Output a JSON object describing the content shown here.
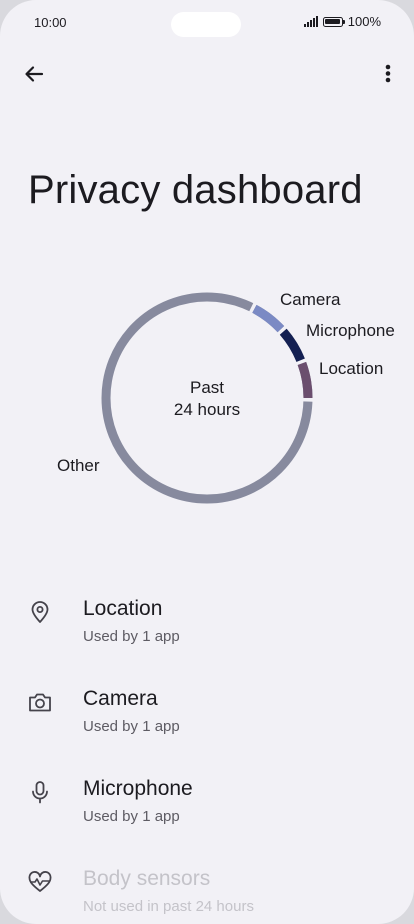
{
  "status_bar": {
    "time": "10:00",
    "battery": "100%"
  },
  "toolbar": {
    "back_icon": "arrow-left-icon",
    "more_icon": "more-vertical-icon"
  },
  "page": {
    "title": "Privacy dashboard"
  },
  "chart_data": {
    "type": "pie",
    "center_label": [
      "Past",
      "24 hours"
    ],
    "slices": [
      {
        "name": "Camera",
        "color": "#7b8ac4"
      },
      {
        "name": "Microphone",
        "color": "#142052"
      },
      {
        "name": "Location",
        "color": "#6b4e6e"
      },
      {
        "name": "Other",
        "color": "#878a9e"
      }
    ]
  },
  "permissions": [
    {
      "name": "Location",
      "status": "Used by 1 app",
      "icon": "location-pin-icon",
      "enabled": true
    },
    {
      "name": "Camera",
      "status": "Used by 1 app",
      "icon": "camera-icon",
      "enabled": true
    },
    {
      "name": "Microphone",
      "status": "Used by 1 app",
      "icon": "microphone-icon",
      "enabled": true
    },
    {
      "name": "Body sensors",
      "status": "Not used in past 24 hours",
      "icon": "heart-pulse-icon",
      "enabled": false
    }
  ],
  "colors": {
    "background": "#f2f1f6",
    "text": "#1c1b20",
    "secondary_text": "#5d5b63",
    "disabled_text": "#c4c3c9"
  }
}
